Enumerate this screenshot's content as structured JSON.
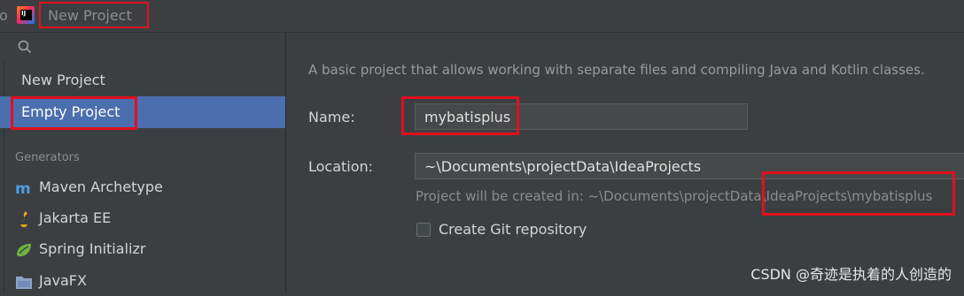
{
  "window": {
    "title": "New Project",
    "app_icon": "intellij-idea-icon",
    "app_icon_text": "IJ",
    "left_edge_glyph": "o"
  },
  "sidebar": {
    "search_icon": "search-icon",
    "items": [
      {
        "label": "New Project",
        "selected": false
      },
      {
        "label": "Empty Project",
        "selected": true
      }
    ],
    "generators_header": "Generators",
    "generators": [
      {
        "label": "Maven Archetype",
        "icon": "maven-icon"
      },
      {
        "label": "Jakarta EE",
        "icon": "jakarta-ee-icon"
      },
      {
        "label": "Spring Initializr",
        "icon": "spring-icon"
      },
      {
        "label": "JavaFX",
        "icon": "javafx-icon"
      }
    ]
  },
  "main": {
    "description": "A basic project that allows working with separate files and compiling Java and Kotlin classes.",
    "name_label": "Name:",
    "name_value": "mybatisplus",
    "location_label": "Location:",
    "location_value": "~\\Documents\\projectData\\IdeaProjects",
    "hint_prefix": "Project will be created in: ~\\Documents\\projectData",
    "hint_suffix": "\\IdeaProjects\\mybatisplus",
    "git_label": "Create Git repository",
    "git_checked": false
  },
  "watermark": "CSDN @奇迹是执着的人创造的",
  "colors": {
    "background": "#3c3f41",
    "selection": "#4b6eaf",
    "annotation_red": "#e0101e"
  }
}
